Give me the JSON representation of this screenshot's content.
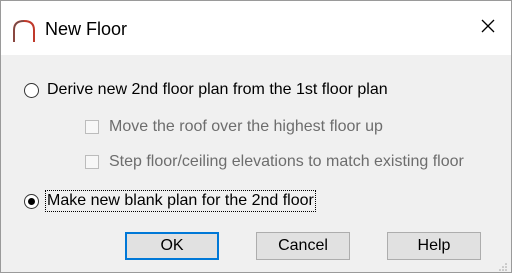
{
  "dialog": {
    "title": "New Floor",
    "close_glyph": "✕"
  },
  "options": {
    "derive_label": "Derive new 2nd floor plan from the 1st floor plan",
    "derive_selected": false,
    "move_roof_label": "Move the roof over the highest floor up",
    "move_roof_checked": false,
    "move_roof_enabled": false,
    "step_floor_label": "Step floor/ceiling elevations to match existing floor",
    "step_floor_checked": false,
    "step_floor_enabled": false,
    "blank_label": "Make new blank plan for the 2nd floor",
    "blank_selected": true
  },
  "buttons": {
    "ok_label": "OK",
    "cancel_label": "Cancel",
    "help_label": "Help"
  },
  "icons": {
    "app": "floor-arch-icon",
    "close": "close-icon",
    "grip": "resize-grip-icon"
  },
  "colors": {
    "accent": "#0078d7",
    "app_icon": "#c0392b"
  }
}
